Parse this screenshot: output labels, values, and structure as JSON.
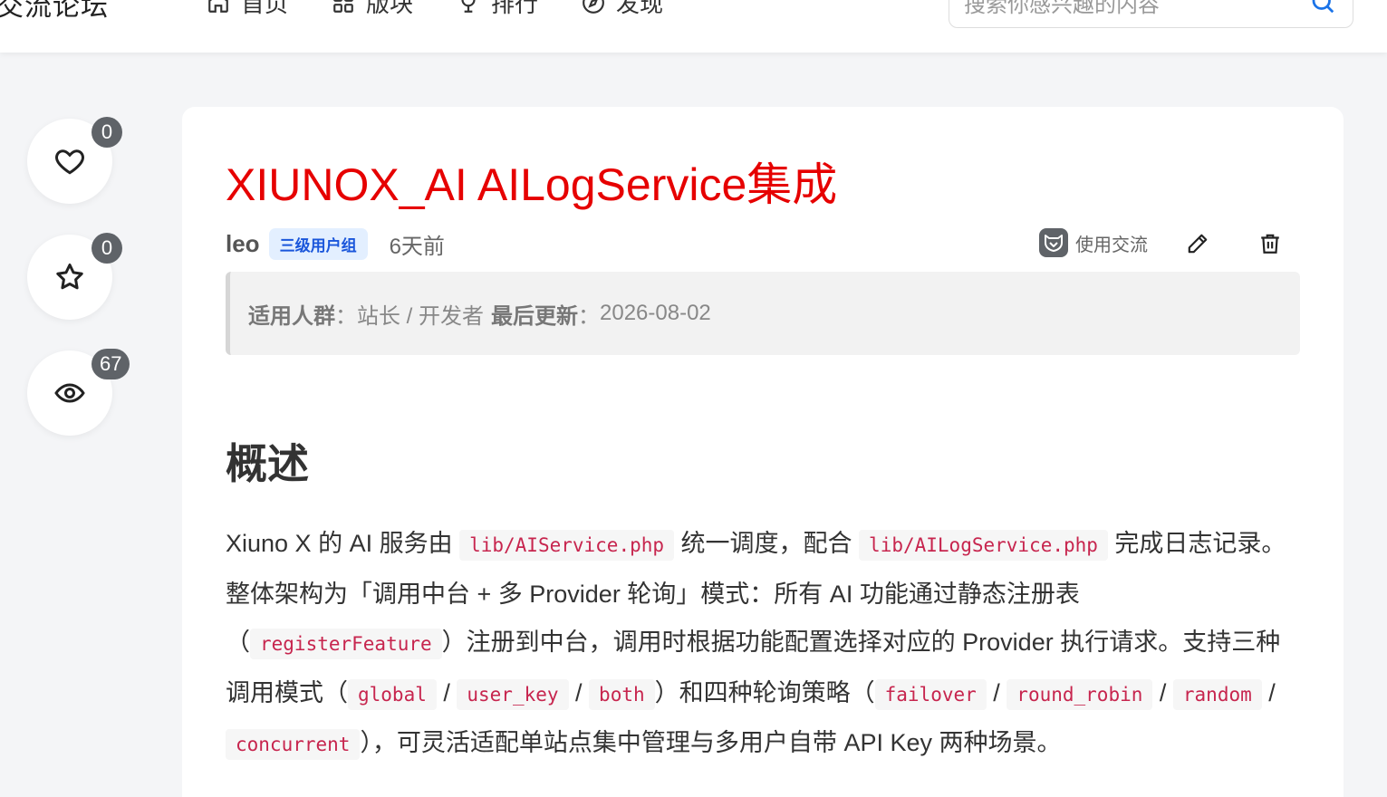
{
  "site": {
    "logo": "交流论坛"
  },
  "nav": {
    "items": [
      {
        "label": "首页",
        "icon": "home-icon"
      },
      {
        "label": "版块",
        "icon": "grid-icon"
      },
      {
        "label": "排行",
        "icon": "trophy-icon"
      },
      {
        "label": "发现",
        "icon": "compass-icon"
      }
    ]
  },
  "search": {
    "placeholder": "搜索你感兴趣的内容",
    "value": ""
  },
  "side": {
    "likes": "0",
    "favorites": "0",
    "views": "67"
  },
  "post": {
    "title": "XIUNOX_AI AILogService集成",
    "author": "leo",
    "user_group": "三级用户组",
    "time": "6天前",
    "forum": "使用交流",
    "info": {
      "audience_label": "适用人群",
      "audience_value": "站长 / 开发者",
      "updated_label": "最后更新",
      "updated_value": "2026-08-02"
    },
    "section_heading": "概述",
    "paragraph": {
      "t1": "Xiuno X 的 AI 服务由 ",
      "c1": "lib/AIService.php",
      "t2": " 统一调度，配合 ",
      "c2": "lib/AILogService.php",
      "t3": " 完成日志记录。整体架构为「调用中台 + 多 Provider 轮询」模式：所有 AI 功能通过静态注册表（",
      "c3": "registerFeature",
      "t4": "）注册到中台，调用时根据功能配置选择对应的 Provider 执行请求。支持三种调用模式（",
      "c4": "global",
      "t5": " / ",
      "c5": "user_key",
      "t6": " / ",
      "c6": "both",
      "t7": "）和四种轮询策略（",
      "c7": "failover",
      "t8": " / ",
      "c8": "round_robin",
      "t9": " / ",
      "c9": "random",
      "t10": " / ",
      "c10": "concurrent",
      "t11": "），可灵活适配单站点集中管理与多用户自带 API Key 两种场景。"
    }
  },
  "colors": {
    "title_red": "#e60000",
    "badge_blue": "#1a56db",
    "code_pink": "#c7254e"
  }
}
